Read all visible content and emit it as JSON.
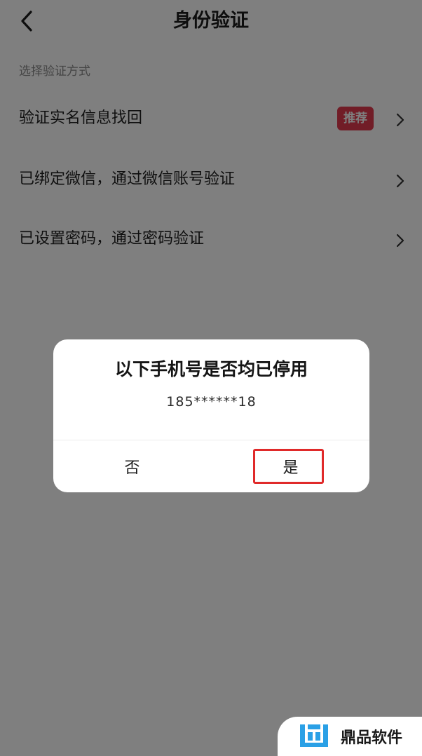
{
  "header": {
    "title": "身份验证",
    "back_icon": "chevron-left-icon"
  },
  "section_label": "选择验证方式",
  "options": [
    {
      "label": "验证实名信息找回",
      "badge": "推荐",
      "icon": "chevron-right-icon"
    },
    {
      "label": "已绑定微信，通过微信账号验证",
      "icon": "chevron-right-icon"
    },
    {
      "label": "已设置密码，通过密码验证",
      "icon": "chevron-right-icon"
    }
  ],
  "dialog": {
    "title": "以下手机号是否均已停用",
    "phone": "185******18",
    "no_label": "否",
    "yes_label": "是",
    "highlight_color": "#e02a2a"
  },
  "watermark": {
    "text": "鼎品软件",
    "logo_color": "#2aa0e6"
  },
  "colors": {
    "badge": "#e23a4f",
    "overlay": "rgba(0,0,0,0.5)"
  }
}
